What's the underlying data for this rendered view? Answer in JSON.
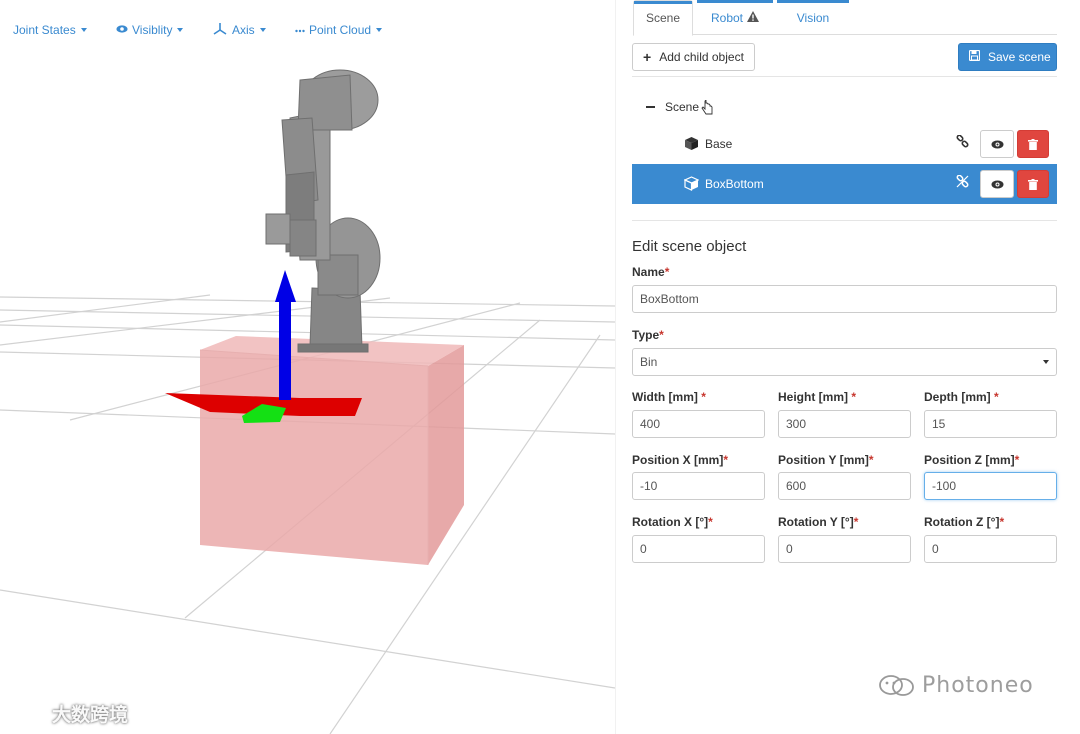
{
  "viewport": {
    "toolbar": [
      {
        "label": "Joint States",
        "icon": ""
      },
      {
        "label": "Visiblity",
        "icon": "eye-icon"
      },
      {
        "label": "Axis",
        "icon": "axis-icon"
      },
      {
        "label": "Point Cloud",
        "icon": "dots-icon"
      }
    ],
    "colors": {
      "box": "#e8a5a5",
      "x_axis": "#e00000",
      "y_axis": "#00e000",
      "z_axis": "#0000ee",
      "robot": "#8a8a8a",
      "grid": "#cfcfcf"
    }
  },
  "tabs": [
    {
      "label": "Scene",
      "active": true
    },
    {
      "label": "Robot",
      "active": false,
      "icon": "warning-icon"
    },
    {
      "label": "Vision",
      "active": false
    }
  ],
  "toolbar": {
    "add_child_label": "Add child object",
    "save_label": "Save scene"
  },
  "tree": {
    "root_label": "Scene",
    "items": [
      {
        "label": "Base",
        "selected": false
      },
      {
        "label": "BoxBottom",
        "selected": true
      }
    ]
  },
  "edit": {
    "title": "Edit scene object",
    "name_label": "Name",
    "name_value": "BoxBottom",
    "type_label": "Type",
    "type_value": "Bin",
    "width_label": "Width [mm] ",
    "width_value": "400",
    "height_label": "Height [mm] ",
    "height_value": "300",
    "depth_label": "Depth [mm] ",
    "depth_value": "15",
    "posx_label": "Position X [mm]",
    "posx_value": "-10",
    "posy_label": "Position Y [mm]",
    "posy_value": "600",
    "posz_label": "Position Z [mm]",
    "posz_value": "-100",
    "rotx_label": "Rotation X [°]",
    "rotx_value": "0",
    "roty_label": "Rotation Y [°]",
    "roty_value": "0",
    "rotz_label": "Rotation Z [°]",
    "rotz_value": "0",
    "required_mark": "*"
  },
  "watermarks": {
    "left": "大数跨境",
    "right": "Photoneo"
  },
  "colors": {
    "accent": "#3a8ad0",
    "danger": "#e0463f",
    "required": "#c7362e"
  }
}
